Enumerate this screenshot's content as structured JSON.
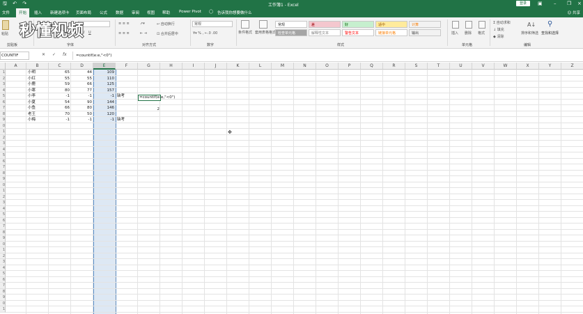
{
  "window": {
    "title": "工作簿1 - Excel",
    "sign_in": "登录"
  },
  "menu": {
    "tabs": [
      "文件",
      "开始",
      "插入",
      "新建选项卡",
      "页面布局",
      "公式",
      "数据",
      "审阅",
      "视图",
      "帮助",
      "Power Pivot"
    ],
    "active_tab": "开始",
    "tell_me": "告诉我你想要做什么",
    "share": "共享"
  },
  "ribbon": {
    "paste": "粘贴",
    "groups": [
      "剪贴板",
      "字体",
      "对齐方式",
      "数字",
      "样式",
      "单元格",
      "编辑"
    ],
    "wrap_text": "自动换行",
    "merge_center": "合并后居中",
    "number_format": "常规",
    "conditional_format": "条件格式",
    "format_as_table": "套用表格格式",
    "styles": [
      {
        "label": "常规",
        "bg": "#ffffff",
        "fg": "#333333"
      },
      {
        "label": "差",
        "bg": "#f4c7ce",
        "fg": "#9c0006"
      },
      {
        "label": "好",
        "bg": "#c6efce",
        "fg": "#006100"
      },
      {
        "label": "适中",
        "bg": "#ffeb9c",
        "fg": "#9c5700"
      },
      {
        "label": "计算",
        "bg": "#f2f2f2",
        "fg": "#fa7d00"
      },
      {
        "label": "检查单元格",
        "bg": "#a5a5a5",
        "fg": "#ffffff"
      },
      {
        "label": "解释性文本",
        "bg": "#ffffff",
        "fg": "#7f7f7f"
      },
      {
        "label": "警告文本",
        "bg": "#ffffff",
        "fg": "#ff0000"
      },
      {
        "label": "链接单元格",
        "bg": "#ffffff",
        "fg": "#fa7d00"
      },
      {
        "label": "输出",
        "bg": "#f2f2f2",
        "fg": "#3f3f3f"
      }
    ],
    "insert": "插入",
    "delete": "删除",
    "format": "格式",
    "autosum": "自动求和",
    "fill": "填充",
    "clear": "清除",
    "sort_filter": "排序和筛选",
    "find_select": "查找和选择"
  },
  "logo_text": "秒懂视频",
  "formula_bar": {
    "name_box": "COUNTIF",
    "formula": "=countif(e:e,\"<0\")",
    "fx": "fx"
  },
  "columns": [
    "A",
    "B",
    "C",
    "D",
    "E",
    "F",
    "G",
    "H",
    "I",
    "J",
    "K",
    "L",
    "M",
    "N",
    "O",
    "P",
    "Q",
    "R",
    "S",
    "T",
    "U",
    "V",
    "W",
    "X",
    "Y",
    "Z"
  ],
  "selected_column": "E",
  "row_numbers": [
    "1",
    "2",
    "3",
    "4",
    "5",
    "6",
    "7",
    "8",
    "9",
    "0",
    "1",
    "2",
    "3",
    "4",
    "5",
    "6",
    "7",
    "8",
    "9",
    "0",
    "1",
    "2",
    "3",
    "4",
    "5",
    "6",
    "7",
    "8",
    "9",
    "0",
    "1",
    "2",
    "3",
    "4",
    "5",
    "6",
    "7",
    "8",
    "9",
    "0",
    "1"
  ],
  "rows": [
    {
      "b": "小明",
      "c": "65",
      "d": "44",
      "e": "109",
      "f": ""
    },
    {
      "b": "小红",
      "c": "55",
      "d": "55",
      "e": "110",
      "f": ""
    },
    {
      "b": "小鹿",
      "c": "59",
      "d": "66",
      "e": "125",
      "f": ""
    },
    {
      "b": "小寒",
      "c": "80",
      "d": "77",
      "e": "157",
      "f": ""
    },
    {
      "b": "小李",
      "c": "-1",
      "d": "-1",
      "e": "-1",
      "f": "缺考"
    },
    {
      "b": "小夏",
      "c": "54",
      "d": "90",
      "e": "144",
      "f": ""
    },
    {
      "b": "小鱼",
      "c": "66",
      "d": "80",
      "e": "146",
      "f": ""
    },
    {
      "b": "老王",
      "c": "70",
      "d": "50",
      "e": "120",
      "f": ""
    },
    {
      "b": "小梅",
      "c": "-1",
      "d": "-1",
      "e": "-1",
      "f": "缺考"
    }
  ],
  "editing_cell": {
    "ref": "G5",
    "content": "=countif(e:e,\"<0\")"
  },
  "result_cell": {
    "ref": "G7",
    "value": "2"
  }
}
